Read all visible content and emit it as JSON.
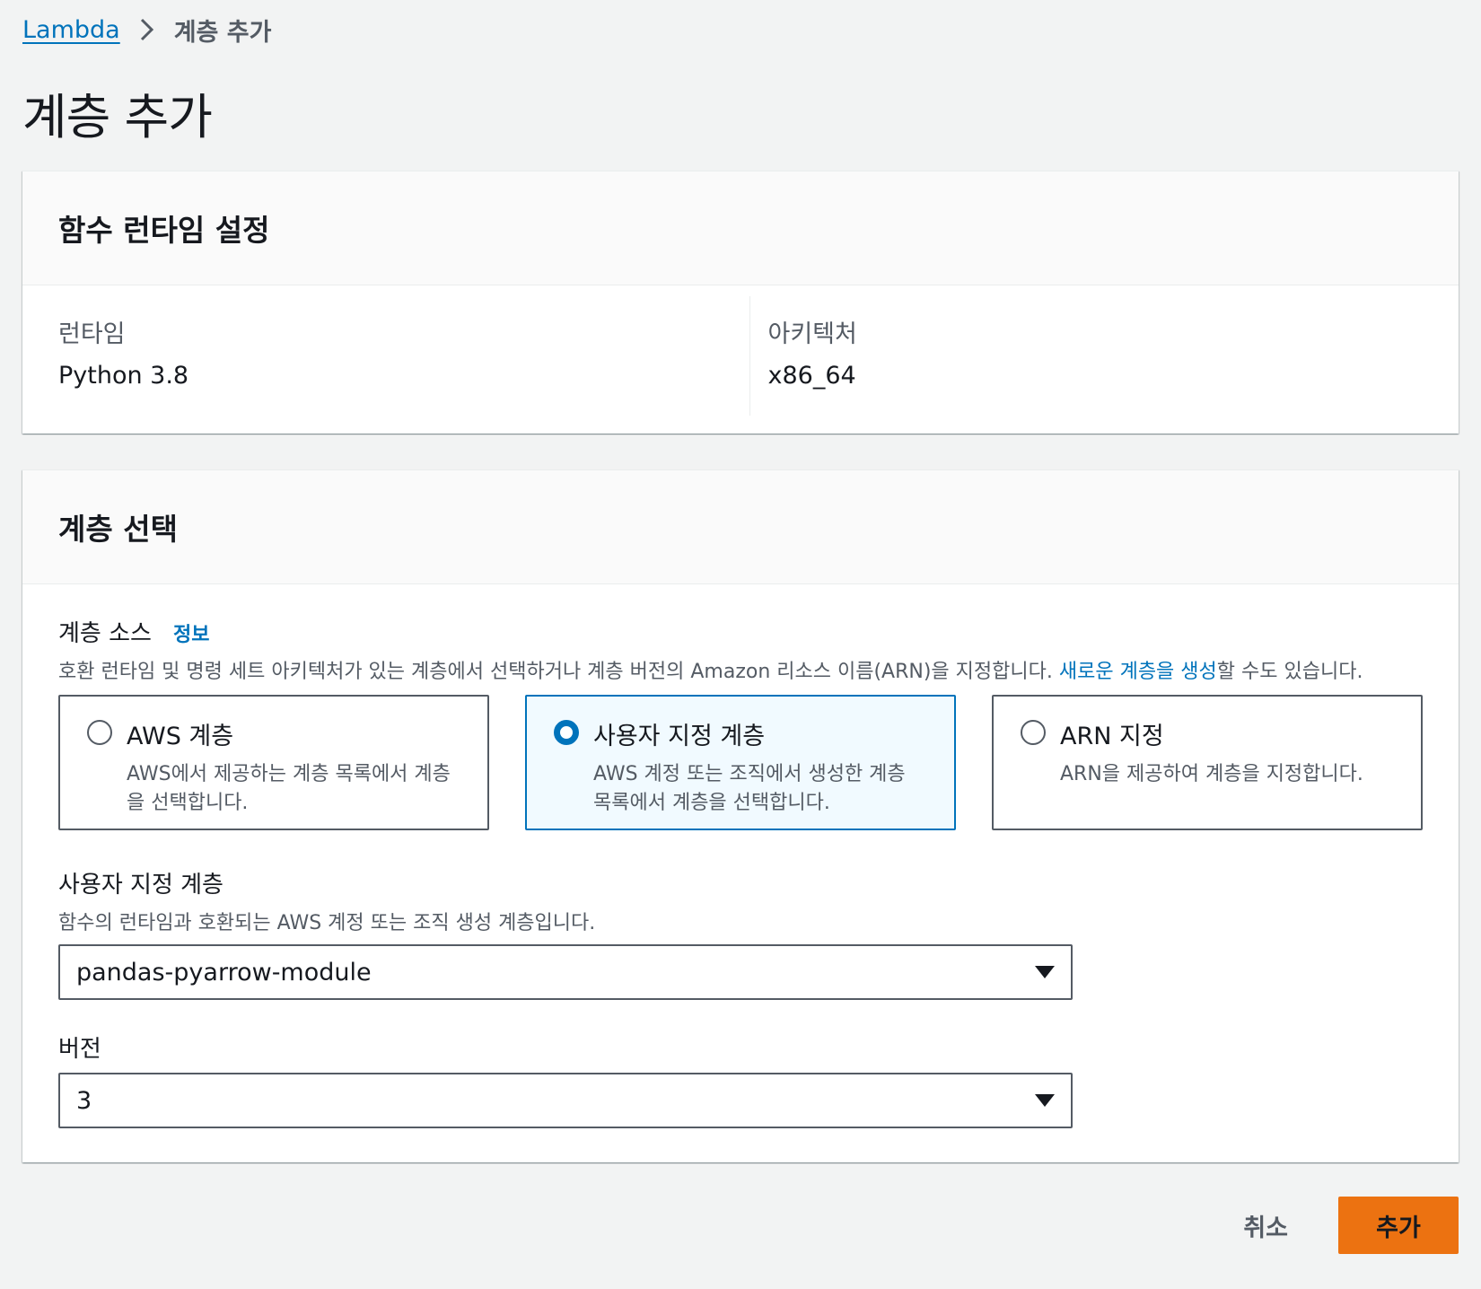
{
  "breadcrumb": {
    "root": "Lambda",
    "current": "계층 추가"
  },
  "page_title": "계층 추가",
  "runtime_section": {
    "title": "함수 런타임 설정",
    "runtime_label": "런타임",
    "runtime_value": "Python 3.8",
    "architecture_label": "아키텍처",
    "architecture_value": "x86_64"
  },
  "layer_section": {
    "title": "계층 선택",
    "source_label": "계층 소스",
    "info_link": "정보",
    "source_desc_prefix": "호환 런타임 및 명령 세트 아키텍처가 있는 계층에서 선택하거나 계층 버전의 Amazon 리소스 이름(ARN)을 지정합니다. ",
    "source_desc_link": "새로운 계층을 생성",
    "source_desc_suffix": "할 수도 있습니다.",
    "options": [
      {
        "title": "AWS 계층",
        "desc": "AWS에서 제공하는 계층 목록에서 계층을 선택합니다.",
        "selected": false
      },
      {
        "title": "사용자 지정 계층",
        "desc": "AWS 계정 또는 조직에서 생성한 계층 목록에서 계층을 선택합니다.",
        "selected": true
      },
      {
        "title": "ARN 지정",
        "desc": "ARN을 제공하여 계층을 지정합니다.",
        "selected": false
      }
    ],
    "custom_layer_label": "사용자 지정 계층",
    "custom_layer_desc": "함수의 런타임과 호환되는 AWS 계정 또는 조직 생성 계층입니다.",
    "custom_layer_value": "pandas-pyarrow-module",
    "version_label": "버전",
    "version_value": "3"
  },
  "footer": {
    "cancel_label": "취소",
    "add_label": "추가"
  },
  "colors": {
    "link": "#0073bb",
    "primary_button": "#ec7211",
    "selected_tile_bg": "#f1faff",
    "page_bg": "#f2f3f3"
  }
}
